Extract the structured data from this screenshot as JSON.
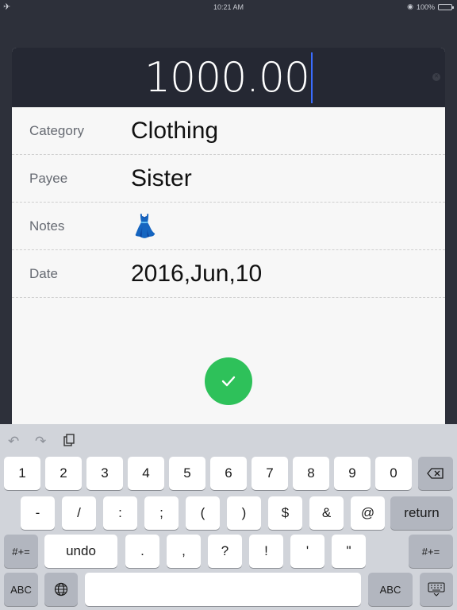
{
  "status": {
    "time": "10:21 AM",
    "battery": "100%"
  },
  "amount": {
    "value": "1000.00"
  },
  "fields": [
    {
      "label": "Category",
      "value": "Clothing"
    },
    {
      "label": "Payee",
      "value": "Sister"
    },
    {
      "label": "Notes",
      "value": "👗"
    },
    {
      "label": "Date",
      "value": "2016,Jun,10"
    }
  ],
  "keyboard": {
    "row1": [
      "1",
      "2",
      "3",
      "4",
      "5",
      "6",
      "7",
      "8",
      "9",
      "0"
    ],
    "row2": [
      "-",
      "/",
      ":",
      ";",
      "(",
      ")",
      "$",
      "&",
      "@"
    ],
    "return_label": "return",
    "shift_label": "#+=",
    "undo_label": "undo",
    "row3": [
      ".",
      ",",
      "?",
      "!",
      "'",
      "\""
    ],
    "abc_label": "ABC"
  },
  "colors": {
    "accent": "#2ec15a",
    "header": "#252833",
    "background": "#2d303a"
  }
}
